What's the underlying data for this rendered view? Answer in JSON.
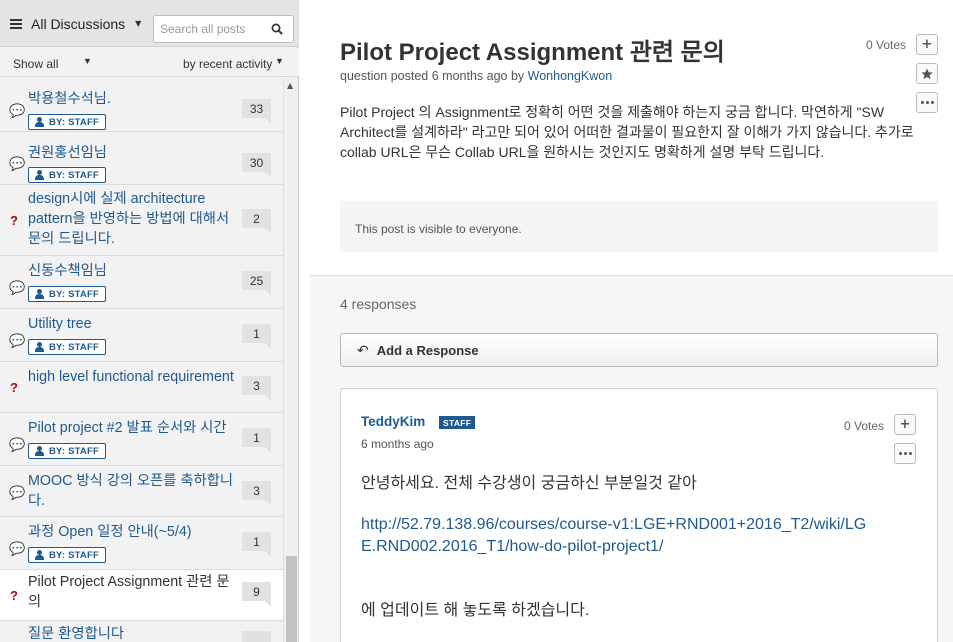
{
  "sidebar": {
    "browse_label": "All Discussions",
    "search_placeholder": "Search all posts",
    "filter_show": "Show all",
    "filter_sort": "by recent activity",
    "staff_badge": "BY: STAFF",
    "threads": [
      {
        "title": "박용철수석님.",
        "count": "33",
        "type": "discussion"
      },
      {
        "title": "권원홍선임님",
        "count": "30",
        "type": "discussion"
      },
      {
        "title": "design시에 실제 architecture pattern을 반영하는 방법에 대해서 문의 드립니다.",
        "count": "2",
        "type": "question"
      },
      {
        "title": "신동수책임님",
        "count": "25",
        "type": "discussion"
      },
      {
        "title": "Utility tree",
        "count": "1",
        "type": "discussion"
      },
      {
        "title": "high level functional requirement",
        "count": "3",
        "type": "question"
      },
      {
        "title": "Pilot project #2 발표 순서와 시간",
        "count": "1",
        "type": "discussion"
      },
      {
        "title": "MOOC 방식 강의 오픈를 축하합니다.",
        "count": "3",
        "type": "discussion"
      },
      {
        "title": "과정 Open 일정 안내(~5/4)",
        "count": "1",
        "type": "discussion"
      },
      {
        "title": "Pilot Project Assignment 관련 문의",
        "count": "9",
        "type": "question"
      },
      {
        "title": "질문 환영합니다",
        "count": "",
        "type": "discussion"
      }
    ]
  },
  "post": {
    "title": "Pilot Project Assignment 관련 문의",
    "meta_prefix": "question posted 6 months ago by",
    "author": "WonhongKwon",
    "votes": "0 Votes",
    "body": "Pilot Project 의 Assignment로 정확히 어떤 것을 제출해야 하는지 궁금 합니다. 막연하게 \"SW Architect를 설계하라\" 라고만 되어 있어 어떠한 결과물이 필요한지 잘 이해가 가지 않습니다. 추가로 collab URL은 무슨 Collab URL을 원하시는 것인지도 명확하게 설명 부탁 드립니다.",
    "visibility": "This post is visible to everyone."
  },
  "responses": {
    "count_label": "4 responses",
    "add_label": "Add a Response",
    "first": {
      "author": "TeddyKim",
      "staff_label": "STAFF",
      "time": "6 months ago",
      "votes": "0 Votes",
      "line1": "안녕하세요. 전체 수강생이 궁금하신 부분일것 같아",
      "link": "http://52.79.138.96/courses/course-v1:LGE+RND001+2016_T2/wiki/LGE.RND002.2016_T1/how-do-pilot-project1/",
      "line2": "에 업데이트 해 놓도록 하겠습니다."
    }
  }
}
